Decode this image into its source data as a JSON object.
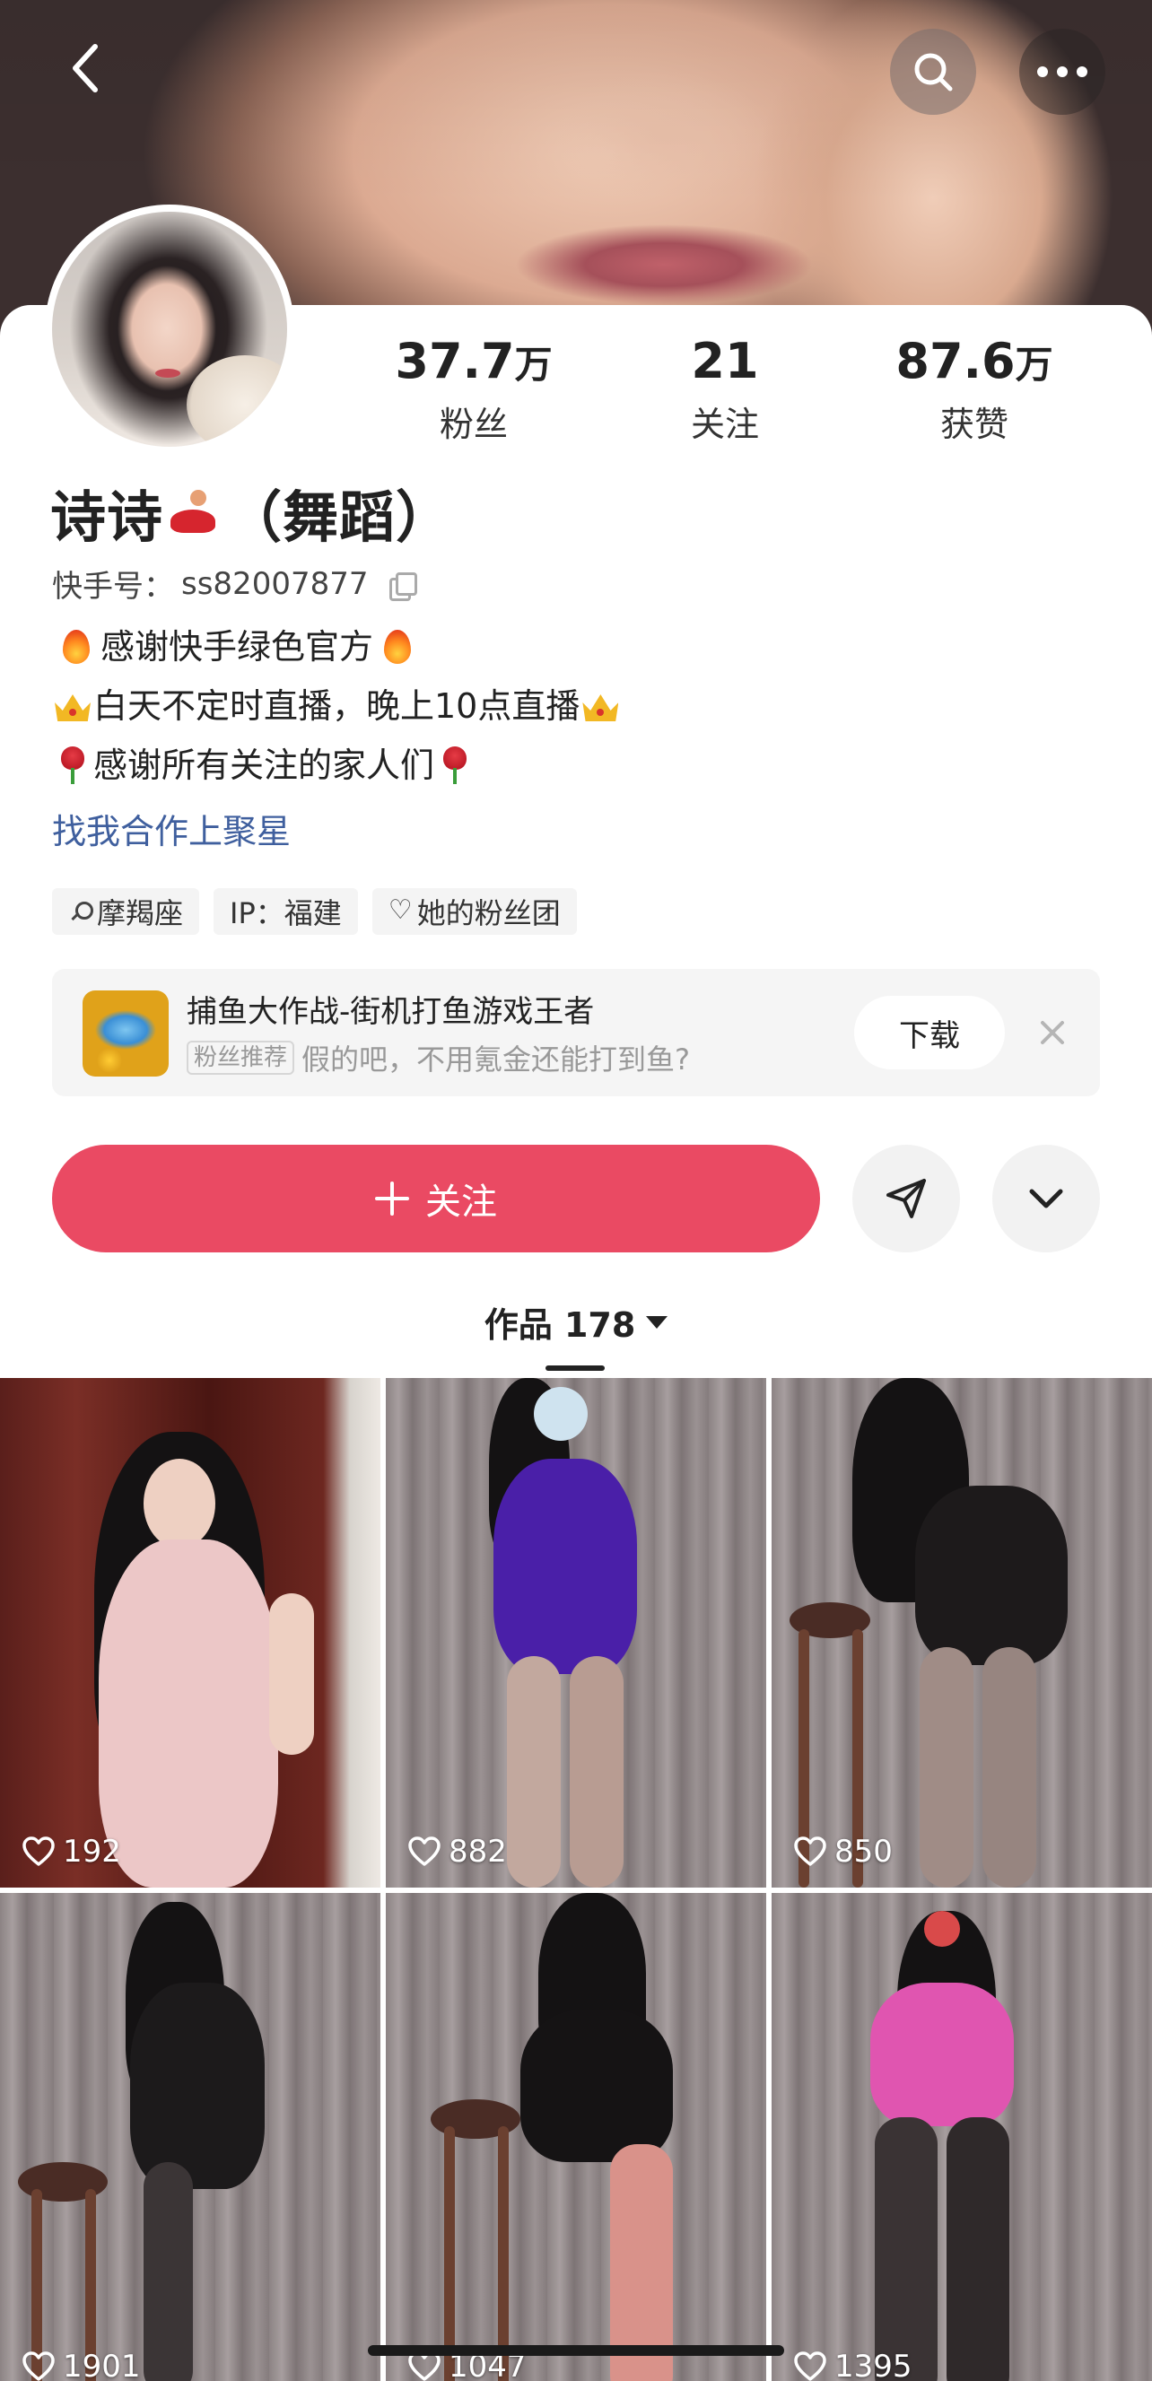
{
  "header": {
    "back_icon": "chevron-left-icon",
    "search_icon": "search-icon",
    "more_icon": "more-horizontal-icon"
  },
  "profile": {
    "name": "诗诗",
    "name_suffix": "（舞蹈）",
    "kuaishou_id_label": "快手号：",
    "kuaishou_id": "ss82007877",
    "stats": [
      {
        "value": "37.7",
        "unit": "万",
        "label": "粉丝"
      },
      {
        "value": "21",
        "unit": "",
        "label": "关注"
      },
      {
        "value": "87.6",
        "unit": "万",
        "label": "获赞"
      }
    ],
    "bio": [
      "感谢快手绿色官方",
      "白天不定时直播，晚上10点直播",
      "感谢所有关注的家人们"
    ],
    "star_link": "找我合作上聚星",
    "tags": [
      {
        "icon": "zodiac-icon",
        "label": "摩羯座"
      },
      {
        "icon": "",
        "label": "IP：福建"
      },
      {
        "icon": "heart-outline-icon",
        "label": "她的粉丝团"
      }
    ]
  },
  "ad": {
    "title": "捕鱼大作战-街机打鱼游戏王者",
    "badge": "粉丝推荐",
    "desc": "假的吧，不用氪金还能打到鱼?",
    "download_label": "下载"
  },
  "actions": {
    "follow_label": "关注",
    "share_icon": "send-icon",
    "expand_icon": "chevron-down-icon"
  },
  "works": {
    "tab_label": "作品 178",
    "items": [
      {
        "likes": "192"
      },
      {
        "likes": "882"
      },
      {
        "likes": "850"
      },
      {
        "likes": "1901"
      },
      {
        "likes": "1047"
      },
      {
        "likes": "1395"
      }
    ]
  },
  "colors": {
    "accent": "#ea4a63",
    "link": "#3f5f9e"
  }
}
